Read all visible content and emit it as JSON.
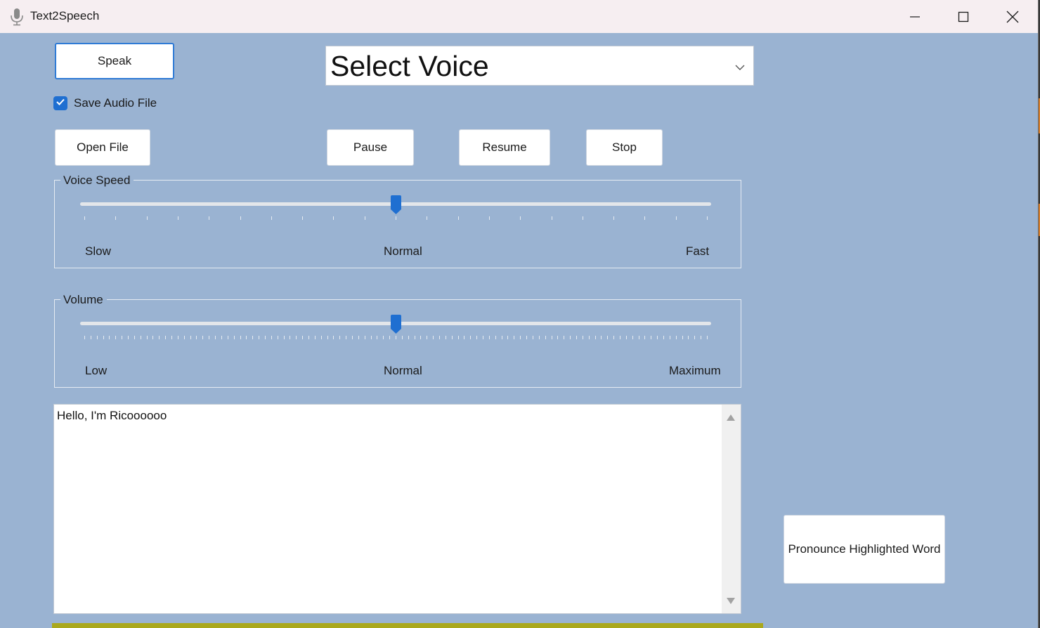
{
  "window": {
    "title": "Text2Speech",
    "app_icon": "microphone-icon",
    "controls": [
      "minimize-icon",
      "maximize-icon",
      "close-icon"
    ]
  },
  "toolbar": {
    "speak_label": "Speak",
    "open_file_label": "Open File",
    "pause_label": "Pause",
    "resume_label": "Resume",
    "stop_label": "Stop"
  },
  "voice_select": {
    "value": "Select Voice"
  },
  "save_audio": {
    "label": "Save Audio File",
    "checked": true
  },
  "voice_speed": {
    "title": "Voice Speed",
    "min_label": "Slow",
    "mid_label": "Normal",
    "max_label": "Fast",
    "value_fraction": 0.5,
    "tick_count": 21
  },
  "volume": {
    "title": "Volume",
    "min_label": "Low",
    "mid_label": "Normal",
    "max_label": "Maximum",
    "value_fraction": 0.5,
    "tick_count": 101
  },
  "textbox": {
    "text": "Hello, I'm Ricoooooo"
  },
  "pronounce": {
    "label": "Pronounce Highlighted Word"
  },
  "colors": {
    "background": "#9ab3d2",
    "titlebar": "#f6eef1",
    "accent": "#1f6fd1"
  }
}
